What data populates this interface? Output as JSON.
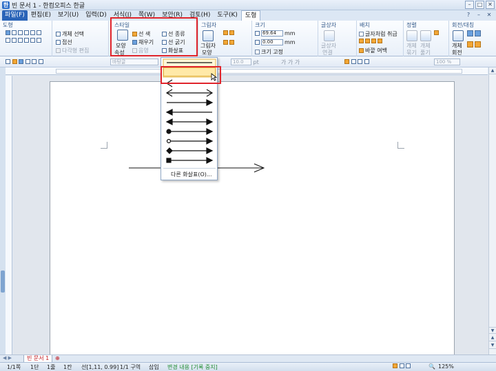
{
  "window": {
    "title": "빈 문서 1 - 한컴오피스 한글",
    "app_icon": "한"
  },
  "menu": {
    "items": [
      "파일(F)",
      "편집(E)",
      "보기(U)",
      "입력(D)",
      "서식(J)",
      "쪽(W)",
      "보안(R)",
      "검토(H)",
      "도구(K)",
      "도형"
    ],
    "active": "도형"
  },
  "ribbon": {
    "draw": {
      "title": "도형",
      "group_select": "개체 선택",
      "join": "접선",
      "polygon_edit": "다각형 편집"
    },
    "style": {
      "title": "스타일",
      "shape_props": "모양",
      "shape_props2": "속성",
      "line_color": "선 색",
      "fill": "채우기",
      "line_kind": "선 종류",
      "line_width": "선 굵기",
      "arrow": "화살표",
      "gradient": "음영"
    },
    "picture": {
      "title": "그림자",
      "shadow": "그림자",
      "shadow2": "모양"
    },
    "size": {
      "title": "크기",
      "width": "69.64",
      "height": "0.00",
      "unit": "mm",
      "fix": "크기 고정"
    },
    "group": {
      "title": "글상자",
      "label1": "글상자",
      "label2": "연결"
    },
    "wrap": {
      "title": "배치",
      "label1": "글자처럼 취급",
      "label2": "바깥 여백"
    },
    "align": {
      "title": "정렬",
      "label1": "개체",
      "label2": "묶기",
      "label3": "개체",
      "label4": "풀기"
    },
    "rotate": {
      "title": "회전/대칭",
      "label1": "개체",
      "label2": "회전"
    }
  },
  "toolbar": {
    "style": "바탕글",
    "font_size": "10.0",
    "unit": "pt",
    "zoom_pct": "100 %"
  },
  "arrow_menu": {
    "other_label": "다른 화살표(O)...",
    "items": [
      "none",
      "right-arrow-hover",
      "left-arrow",
      "both-arrow",
      "right-arrow",
      "left-open",
      "right-filled",
      "dot-both",
      "circle-both",
      "diamond-both",
      "square-both"
    ]
  },
  "tabs": {
    "doc_name": "빈 문서 1"
  },
  "status": {
    "page": "1/1쪽",
    "section": "1단",
    "line": "1줄",
    "col": "1칸",
    "coords": "선[1,11, 0.99]",
    "sections": "1/1 구역",
    "mode": "삽입",
    "track": "변경 내용 [기록 중지]",
    "zoom": "125%"
  }
}
